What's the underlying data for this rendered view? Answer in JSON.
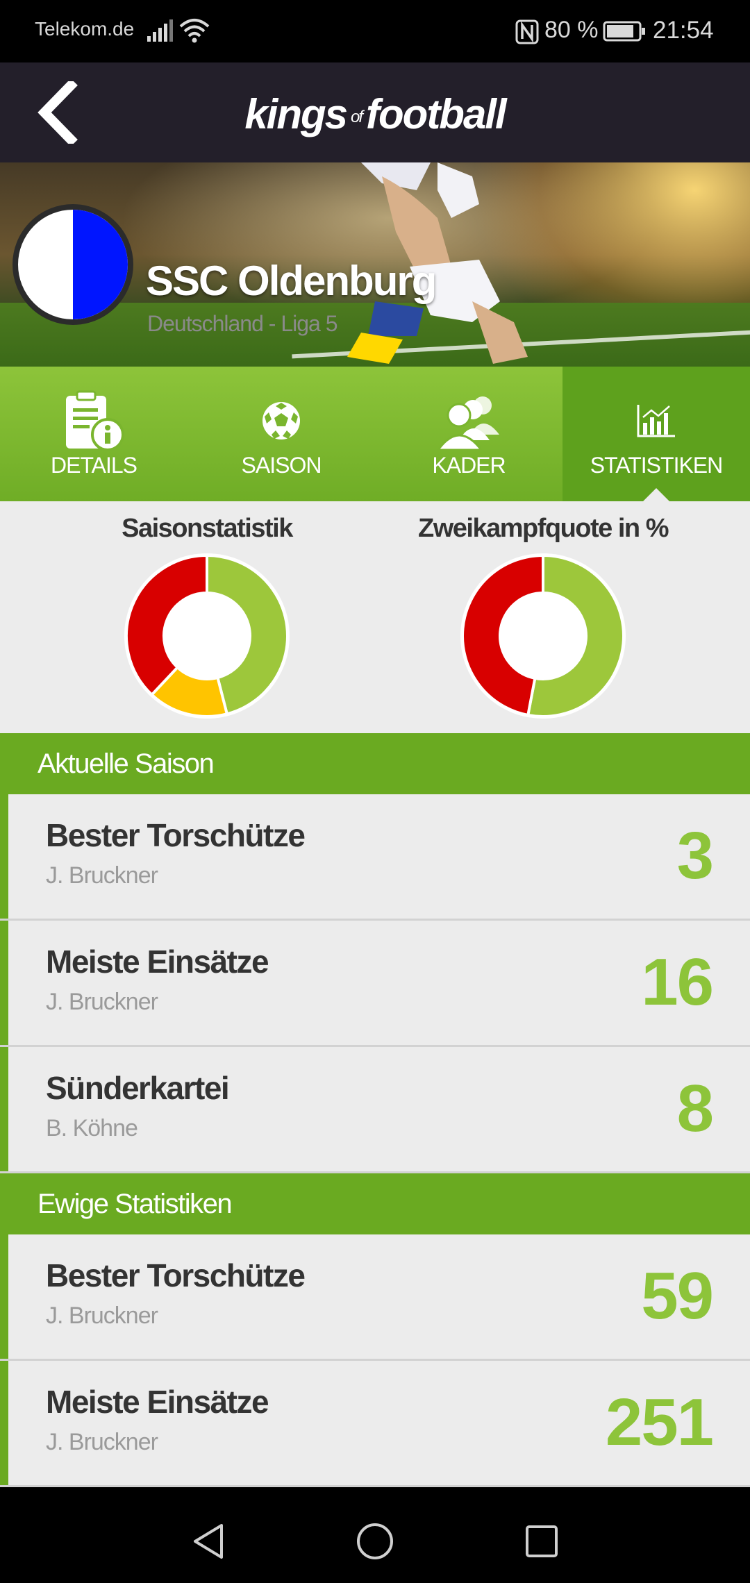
{
  "status_bar": {
    "carrier": "Telekom.de",
    "battery_percent": "80 %",
    "time": "21:54"
  },
  "app_bar": {
    "logo_kings": "kings",
    "logo_of": "of",
    "logo_football": "football"
  },
  "team": {
    "name": "SSC Oldenburg",
    "league": "Deutschland - Liga 5",
    "crest_colors": [
      "#ffffff",
      "#0015ff"
    ]
  },
  "tabs": [
    {
      "label": "DETAILS",
      "icon": "document-info-icon",
      "active": false
    },
    {
      "label": "SAISON",
      "icon": "soccer-ball-icon",
      "active": false
    },
    {
      "label": "KADER",
      "icon": "people-icon",
      "active": false
    },
    {
      "label": "STATISTIKEN",
      "icon": "bar-chart-icon",
      "active": true
    }
  ],
  "chart_data": [
    {
      "type": "pie",
      "title": "Saisonstatistik",
      "slices": [
        {
          "value": 0.46,
          "color": "#9dc73b"
        },
        {
          "value": 0.16,
          "color": "#ffc400"
        },
        {
          "value": 0.38,
          "color": "#d80000"
        }
      ]
    },
    {
      "type": "pie",
      "title": "Zweikampfquote in %",
      "slices": [
        {
          "value": 0.53,
          "color": "#9dc73b"
        },
        {
          "value": 0.47,
          "color": "#d80000"
        }
      ]
    }
  ],
  "current_season": {
    "title": "Aktuelle Saison",
    "rows": [
      {
        "label": "Bester Torschütze",
        "name": "J. Bruckner",
        "value": "3"
      },
      {
        "label": "Meiste Einsätze",
        "name": "J. Bruckner",
        "value": "16"
      },
      {
        "label": "Sünderkartei",
        "name": "B. Köhne",
        "value": "8"
      }
    ]
  },
  "all_time": {
    "title": "Ewige Statistiken",
    "rows": [
      {
        "label": "Bester Torschütze",
        "name": "J. Bruckner",
        "value": "59"
      },
      {
        "label": "Meiste Einsätze",
        "name": "J. Bruckner",
        "value": "251"
      }
    ]
  },
  "colors": {
    "brand_green": "#6aaa21",
    "value_green": "#8dc43a",
    "app_bar": "#231f2a"
  }
}
